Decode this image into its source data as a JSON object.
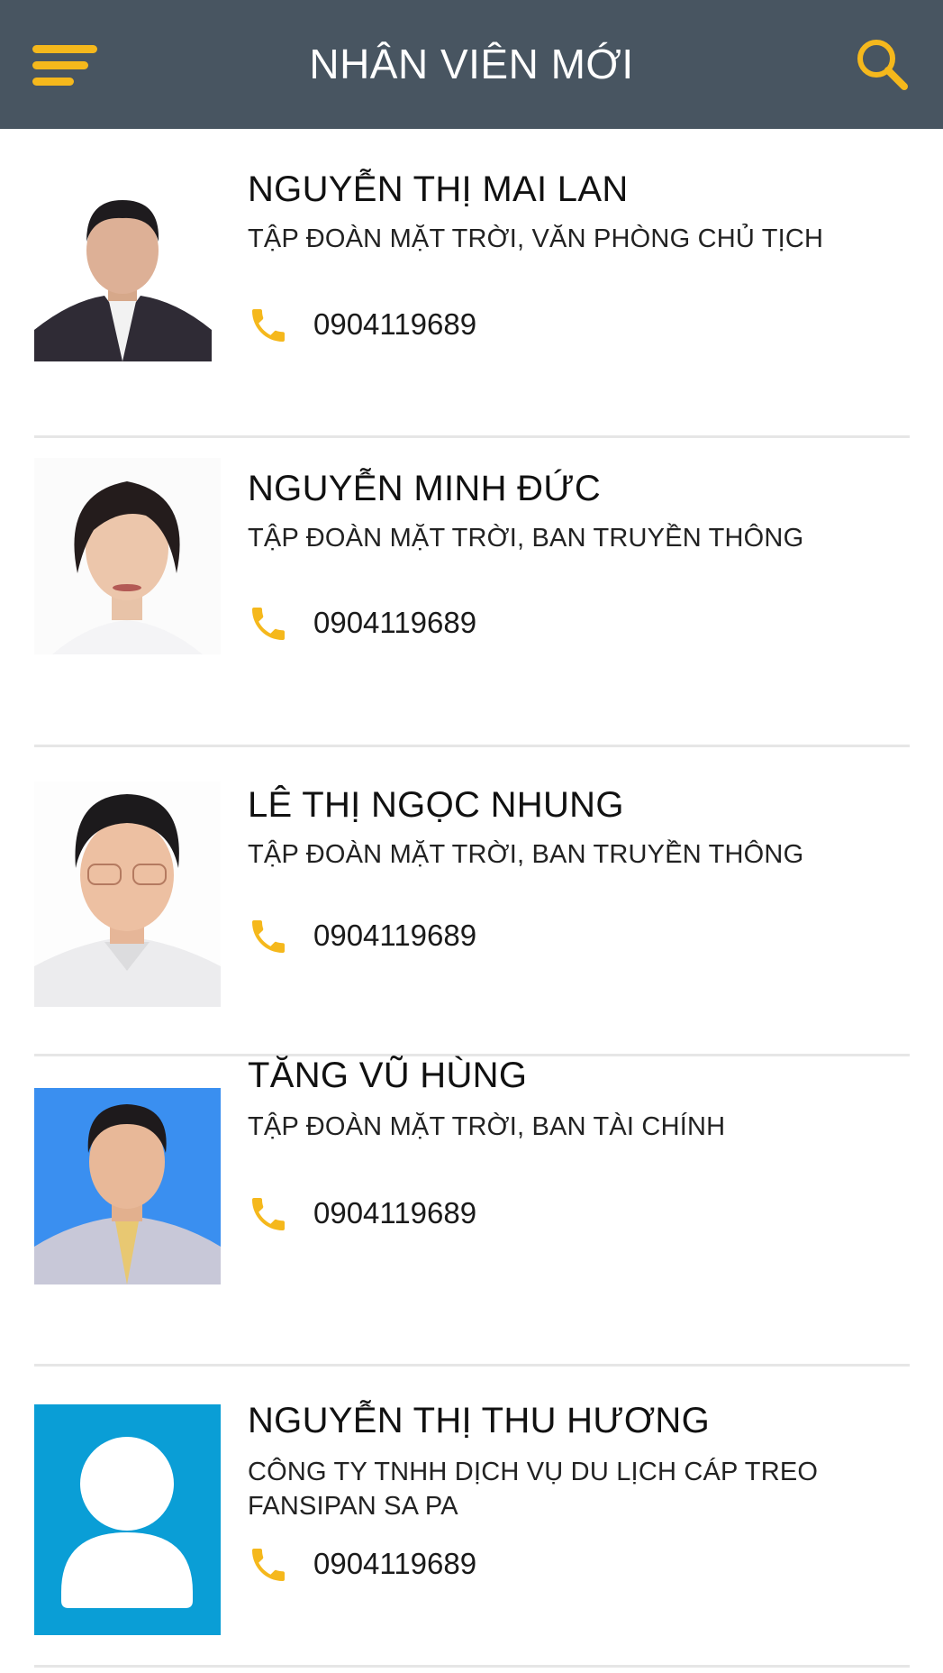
{
  "header": {
    "title": "NHÂN VIÊN MỚI",
    "menu_icon": "hamburger-menu-icon",
    "search_icon": "search-icon",
    "accent_color": "#f5b81c",
    "background_color": "#485561"
  },
  "employees": [
    {
      "name": "NGUYỄN THỊ MAI LAN",
      "org": "TẬP ĐOÀN MẶT TRỜI, VĂN PHÒNG CHỦ TỊCH",
      "phone": "0904119689",
      "avatar": "photo-man-suit"
    },
    {
      "name": "NGUYỄN MINH ĐỨC",
      "org": "TẬP ĐOÀN MẶT TRỜI, BAN TRUYỀN THÔNG",
      "phone": "0904119689",
      "avatar": "photo-woman-short-hair"
    },
    {
      "name": "LÊ THỊ NGỌC NHUNG",
      "org": "TẬP ĐOÀN MẶT TRỜI, BAN TRUYỀN THÔNG",
      "phone": "0904119689",
      "avatar": "photo-man-glasses"
    },
    {
      "name": "TĂNG VŨ HÙNG",
      "org": "TẬP ĐOÀN MẶT TRỜI, BAN TÀI CHÍNH",
      "phone": "0904119689",
      "avatar": "photo-man-blue-background"
    },
    {
      "name": "NGUYỄN THỊ THU HƯƠNG",
      "org": "CÔNG TY TNHH DỊCH VỤ DU LỊCH CÁP TREO FANSIPAN SA PA",
      "phone": "0904119689",
      "avatar": "default-user-icon"
    }
  ]
}
